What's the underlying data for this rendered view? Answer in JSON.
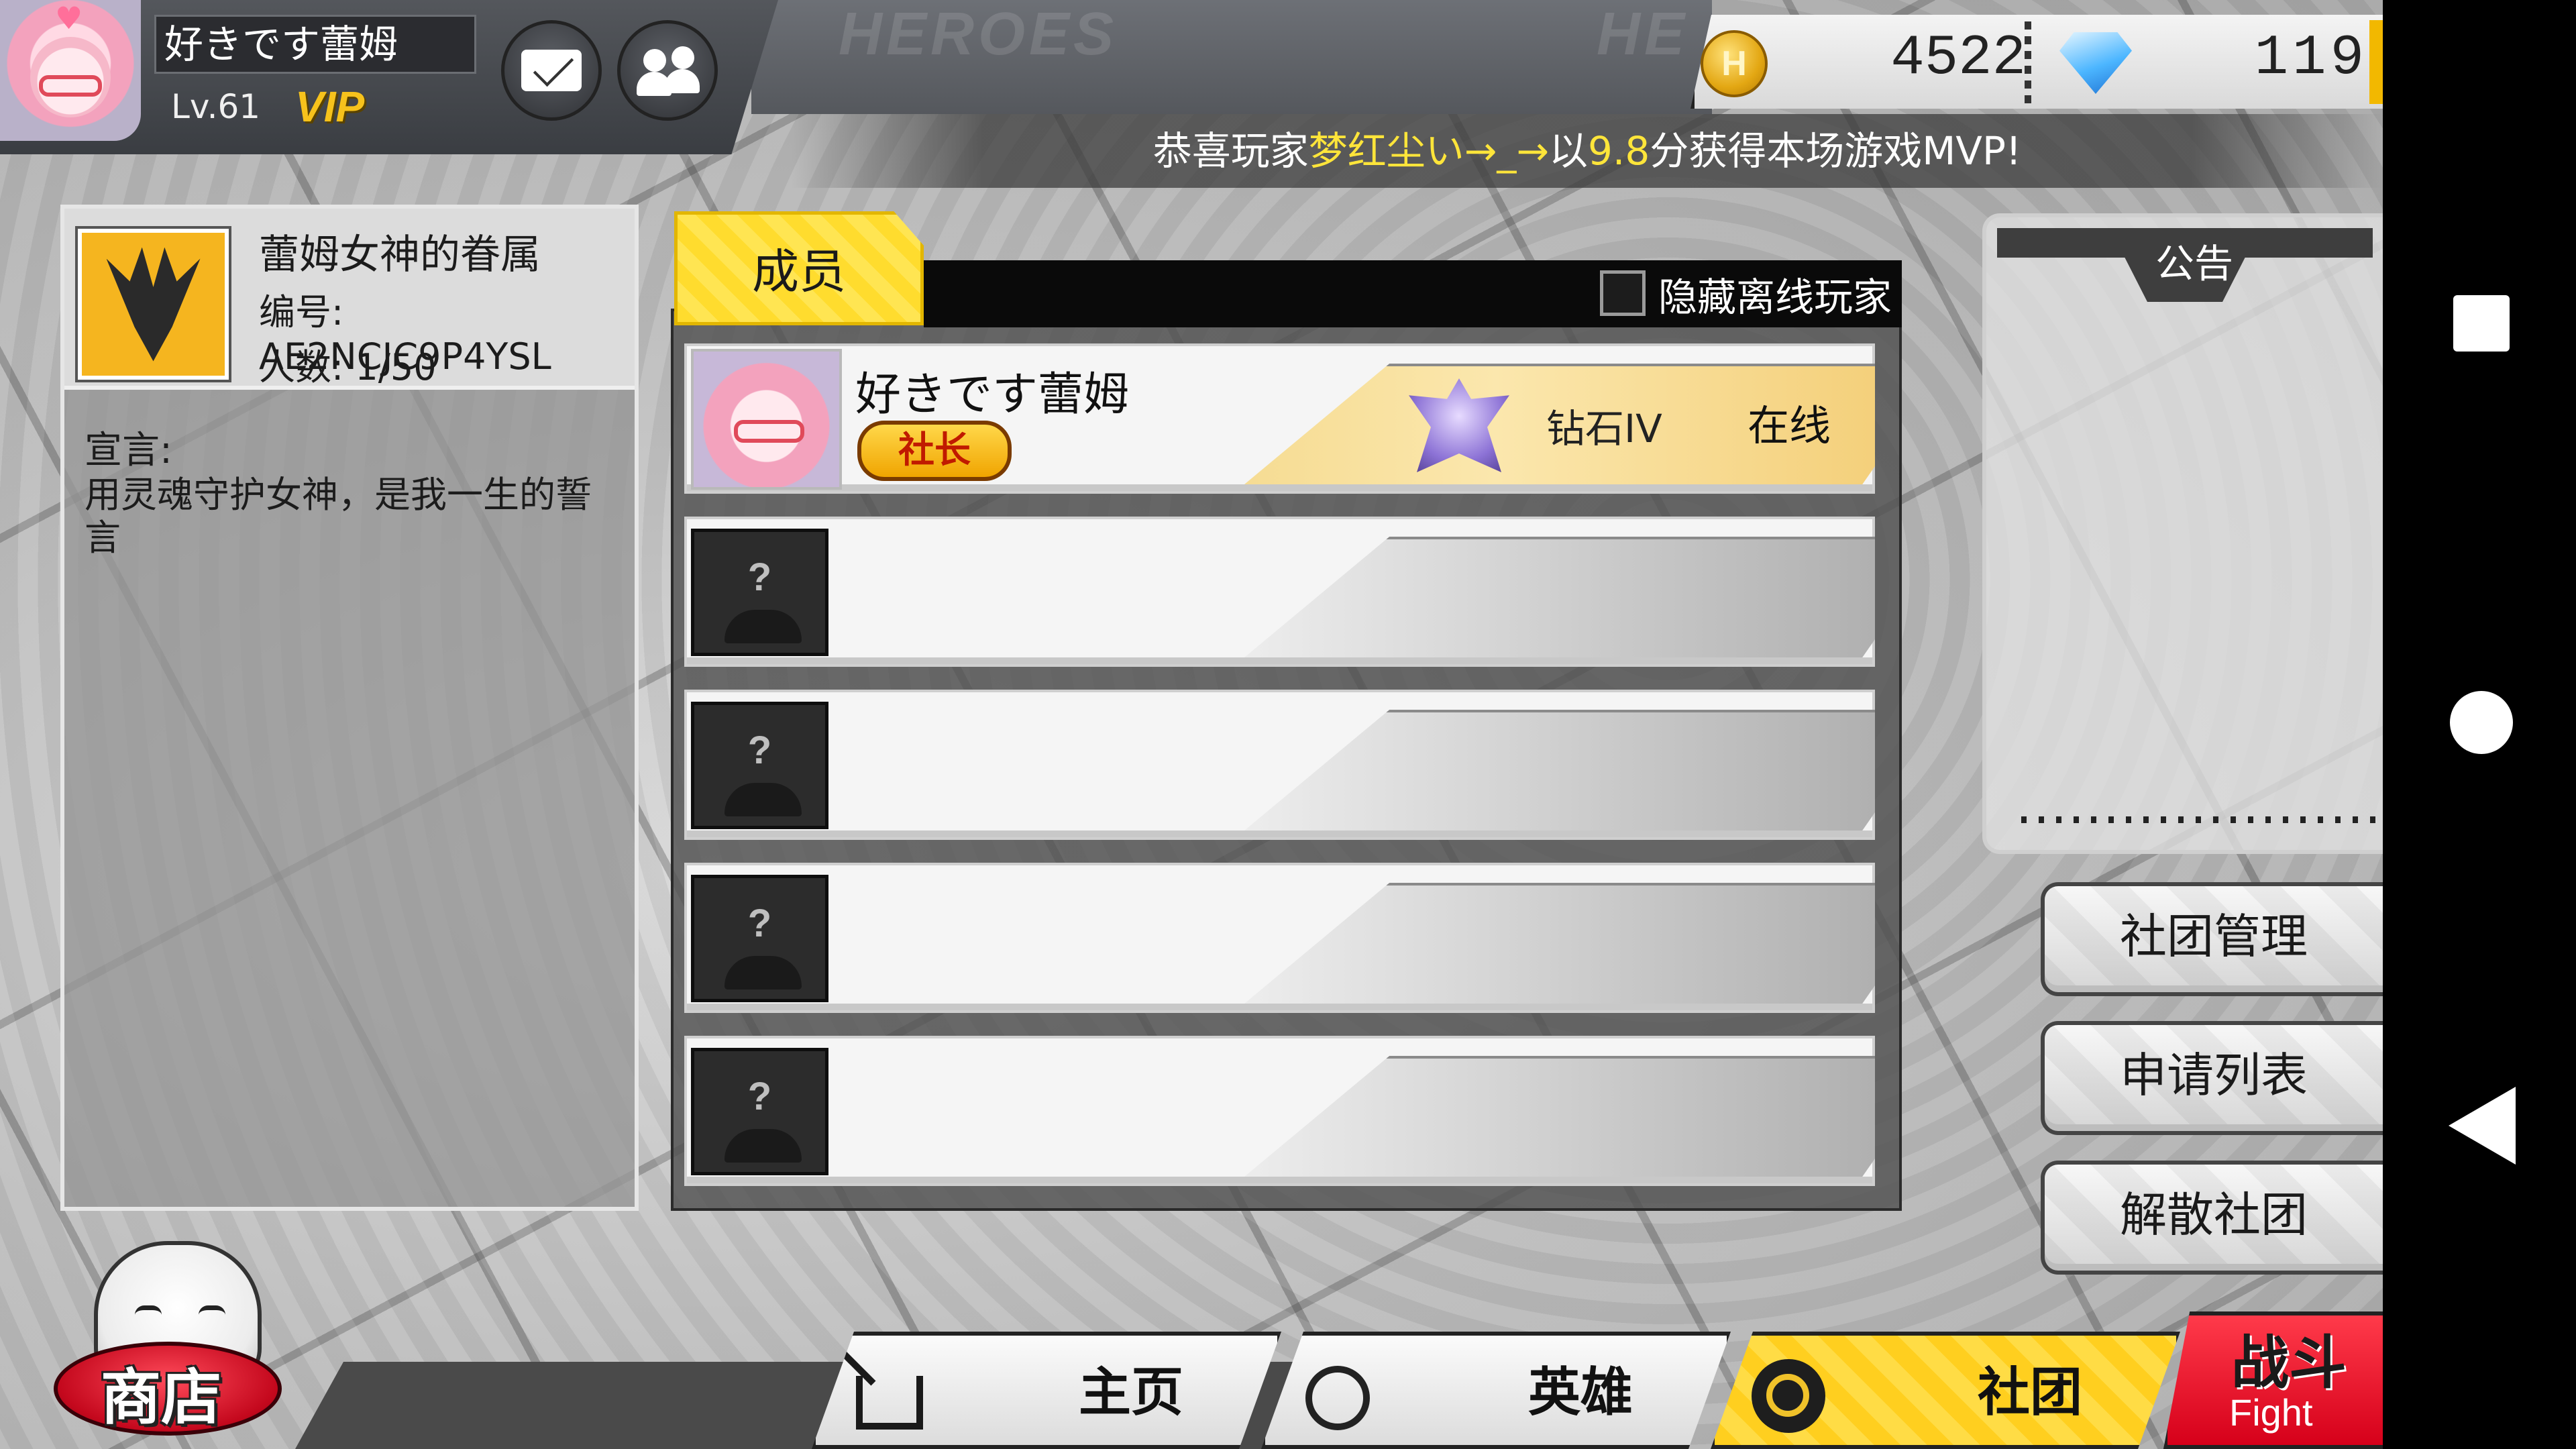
{
  "top_bar": {
    "player_name": "好きです蕾姆",
    "level": "Lv.61",
    "vip_label": "VIP",
    "ghost_text": "HEROES",
    "ghost_text_2": "HE",
    "icons": {
      "mail": "mail-icon",
      "friends": "friends-icon"
    }
  },
  "currency": {
    "coin_symbol": "H",
    "gold": "4522",
    "gems": "119"
  },
  "announcement": {
    "prefix": "恭喜玩家",
    "player": "梦红尘い→_→",
    "middle": "以",
    "score": "9.8",
    "suffix": "分获得本场游戏MVP!"
  },
  "guild": {
    "name": "蕾姆女神的眷属",
    "id_line": "编号: AE2NCJC9P4YSL",
    "count_line": "人数: 1/50",
    "declaration_label": "宣言:",
    "declaration_text": "用灵魂守护女神，是我一生的誓言"
  },
  "members": {
    "tab_label": "成员",
    "hide_offline_label": "隐藏离线玩家",
    "hide_offline_checked": false,
    "leader": {
      "name": "好きです蕾姆",
      "badge": "社长",
      "rank": "钻石IV",
      "status": "在线"
    },
    "empty_slot_mark": "?",
    "empty_slots": 4
  },
  "notice": {
    "title": "公告"
  },
  "side_buttons": {
    "manage": "社团管理",
    "applications": "申请列表",
    "disband": "解散社团"
  },
  "bottom_nav": {
    "shop": "商店",
    "home": "主页",
    "heroes": "英雄",
    "guild": "社团",
    "fight_cn": "战斗",
    "fight_en": "Fight",
    "active": "guild"
  },
  "colors": {
    "accent_yellow": "#ffd83a",
    "highlight_text": "#ffe53a",
    "fight_red": "#e0001c",
    "leader_row_gold": "#f6dc93"
  }
}
